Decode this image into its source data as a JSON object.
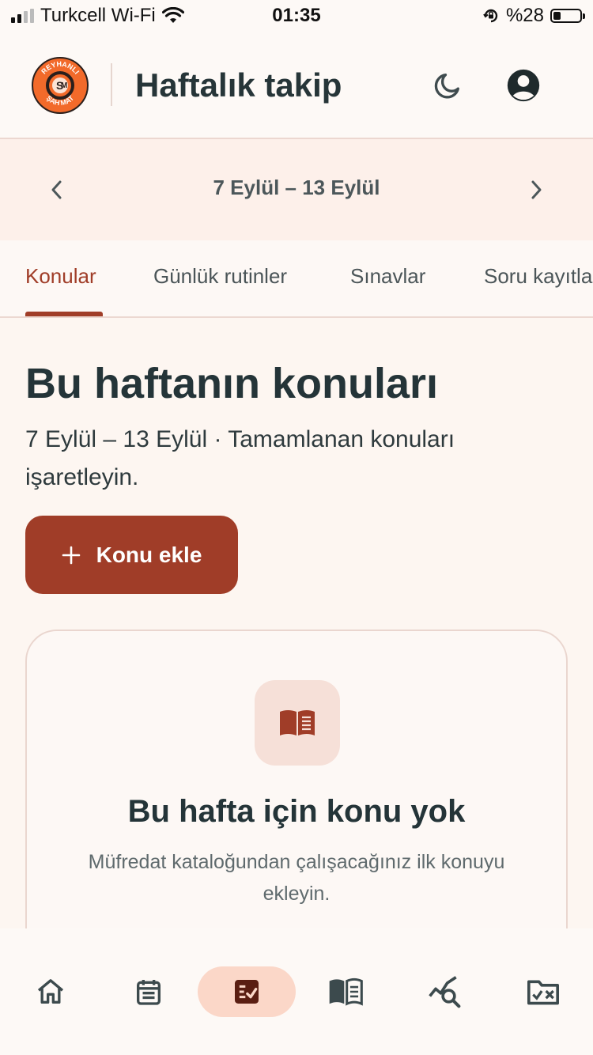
{
  "status_bar": {
    "carrier": "Turkcell Wi-Fi",
    "time": "01:35",
    "battery_percent": "%28",
    "battery_level": 0.28
  },
  "header": {
    "title": "Haftalık takip",
    "logo_text_top": "REYHANLI",
    "logo_text_bottom": "ŞAH MAT",
    "theme_icon": "moon-icon",
    "account_icon": "account-circle-icon"
  },
  "week_nav": {
    "label": "7 Eylül – 13 Eylül",
    "prev_icon": "chevron-left-icon",
    "next_icon": "chevron-right-icon"
  },
  "tabs": [
    {
      "label": "Konular",
      "active": true
    },
    {
      "label": "Günlük rutinler",
      "active": false
    },
    {
      "label": "Sınavlar",
      "active": false
    },
    {
      "label": "Soru kayıtla",
      "active": false
    }
  ],
  "main": {
    "heading": "Bu haftanın konuları",
    "subtitle": "7 Eylül – 13 Eylül · Tamamlanan konuları işaretleyin.",
    "add_button_label": "Konu ekle",
    "empty_state": {
      "icon": "book-open-icon",
      "title": "Bu hafta için konu yok",
      "description": "Müfredat kataloğundan çalışacağınız ilk konuyu ekleyin."
    }
  },
  "bottom_nav": [
    {
      "icon": "home-icon",
      "active": false
    },
    {
      "icon": "calendar-icon",
      "active": false
    },
    {
      "icon": "checklist-icon",
      "active": true
    },
    {
      "icon": "book-icon",
      "active": false
    },
    {
      "icon": "analytics-search-icon",
      "active": false
    },
    {
      "icon": "folder-x-icon",
      "active": false
    }
  ],
  "colors": {
    "accent": "#a03d28",
    "background": "#fdf6f1",
    "text_primary": "#243438",
    "nav_active_bg": "#fbd7c8"
  }
}
